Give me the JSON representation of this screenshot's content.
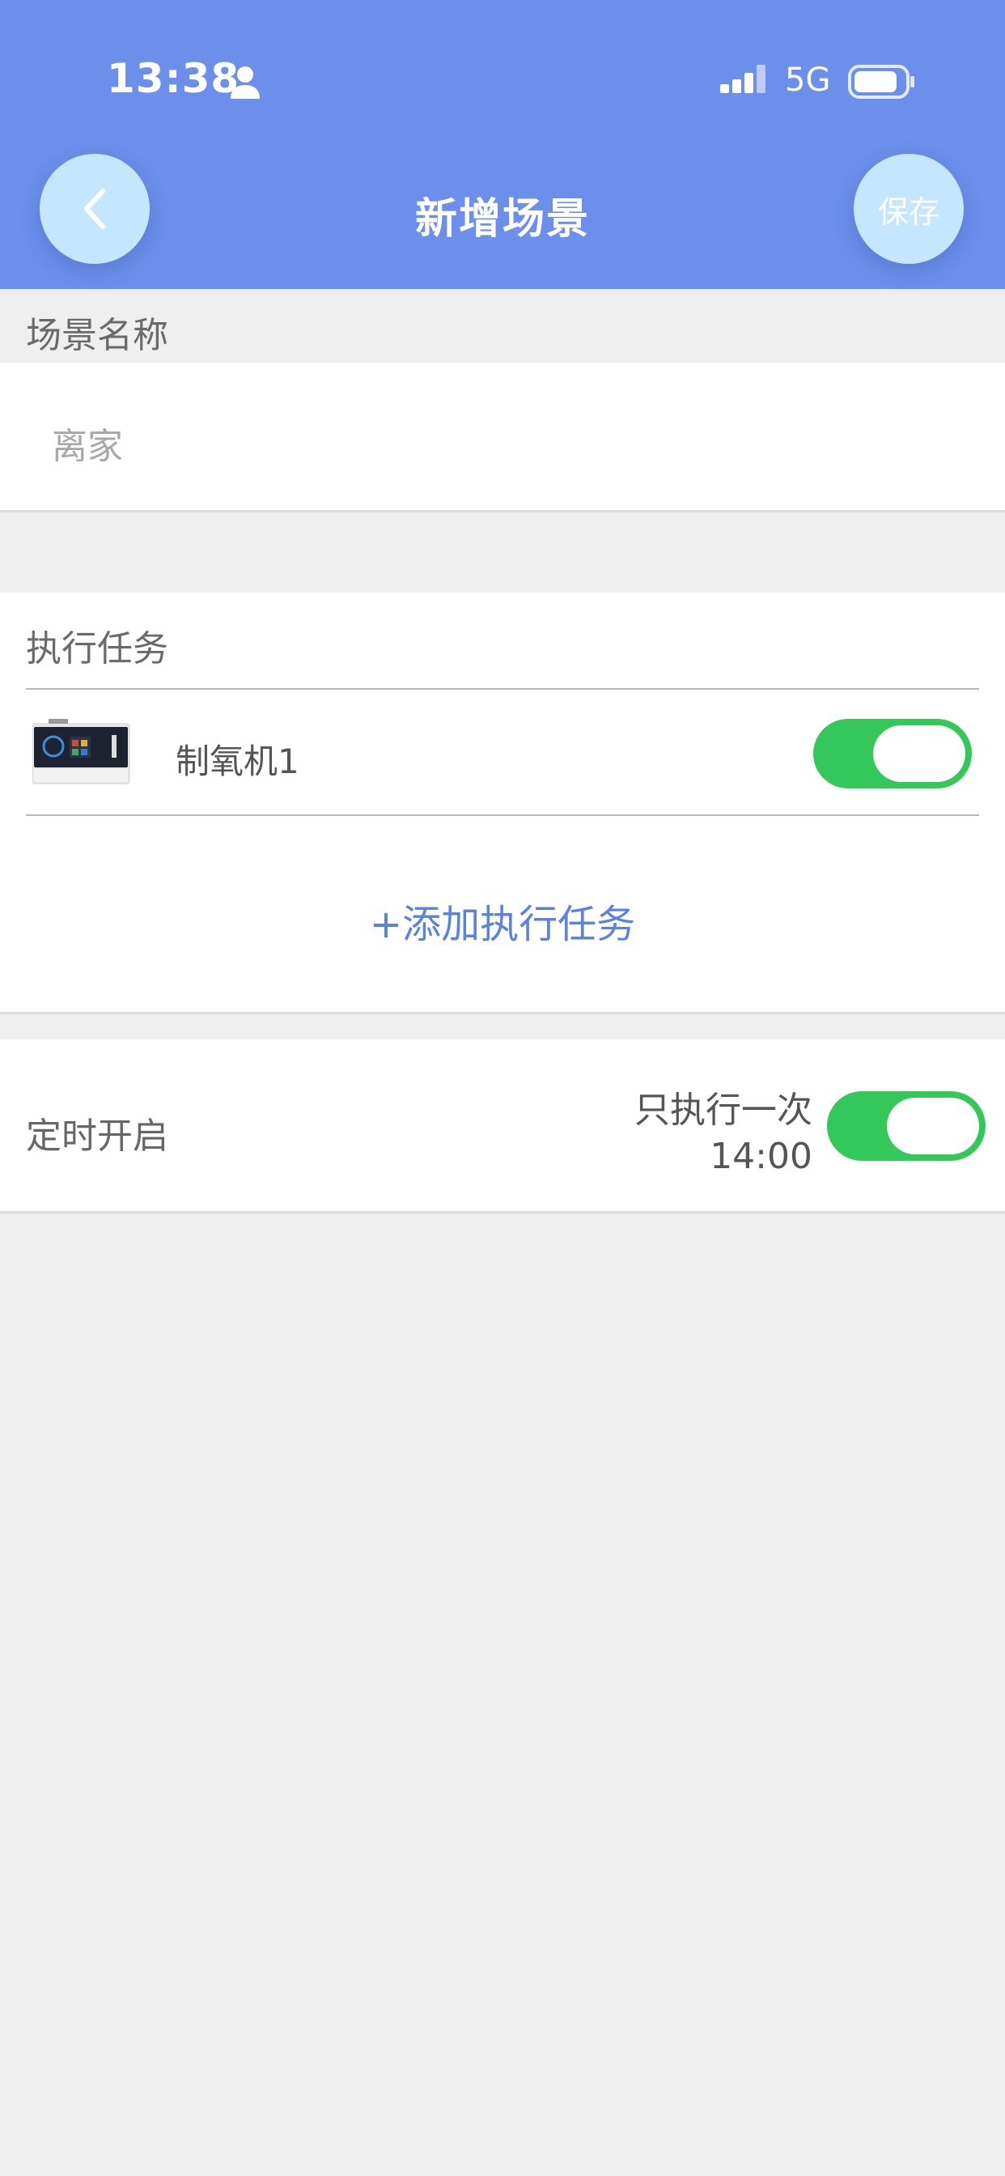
{
  "status_bar": {
    "time": "13:38",
    "network": "5G",
    "icons": [
      "person-icon",
      "signal-icon",
      "battery-icon"
    ]
  },
  "header": {
    "title": "新增场景",
    "back_icon": "chevron-left-icon",
    "save_label": "保存"
  },
  "scene_name": {
    "label": "场景名称",
    "value": "离家"
  },
  "tasks": {
    "label": "执行任务",
    "items": [
      {
        "name": "制氧机1",
        "enabled": true,
        "icon": "oxygen-concentrator-image"
      }
    ],
    "add_label": "+添加执行任务"
  },
  "timer": {
    "label": "定时开启",
    "mode": "只执行一次",
    "time": "14:00",
    "enabled": true
  },
  "colors": {
    "header_bg": "#6b8fea",
    "button_bg": "#c5e6ff",
    "toggle_on": "#34c759",
    "link": "#5b82df",
    "page_bg": "#efefef"
  }
}
